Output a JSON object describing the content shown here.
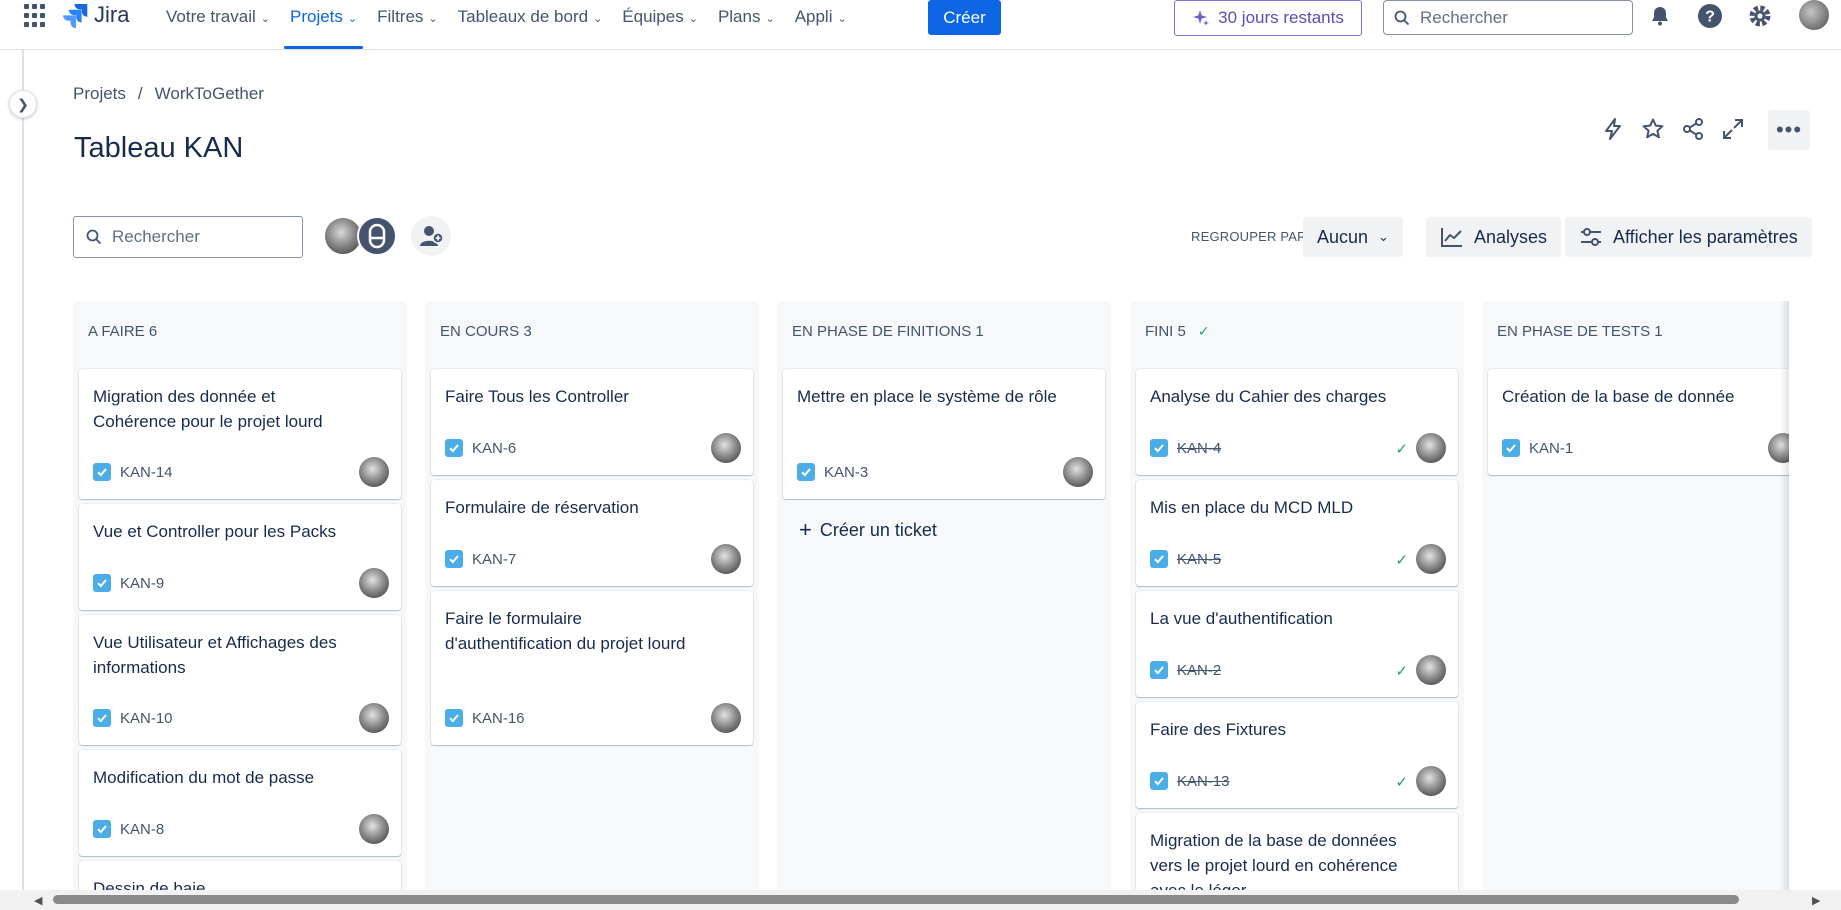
{
  "nav": {
    "logo": "Jira",
    "items": [
      {
        "label": "Votre travail"
      },
      {
        "label": "Projets"
      },
      {
        "label": "Filtres"
      },
      {
        "label": "Tableaux de bord"
      },
      {
        "label": "Équipes"
      },
      {
        "label": "Plans"
      },
      {
        "label": "Appli"
      }
    ],
    "active_item": "Projets",
    "create_label": "Créer",
    "trial_label": "30 jours restants",
    "search_placeholder": "Rechercher",
    "accent_color": "#0c66e4"
  },
  "breadcrumb": {
    "root": "Projets",
    "separator": "/",
    "project": "WorkToGether"
  },
  "page": {
    "title": "Tableau KAN"
  },
  "toolbar": {
    "search_placeholder": "Rechercher",
    "group_by_label": "REGROUPER PAR",
    "group_by_value": "Aucun",
    "analyses_label": "Analyses",
    "settings_label": "Afficher les paramètres"
  },
  "columns": [
    {
      "header": "A FAIRE 6",
      "cards": [
        {
          "title": "Migration des donnée et Cohérence pour le projet lourd",
          "key": "KAN-14",
          "done": false
        },
        {
          "title": "Vue et Controller pour les Packs",
          "key": "KAN-9",
          "done": false
        },
        {
          "title": "Vue Utilisateur et Affichages des informations",
          "key": "KAN-10",
          "done": false
        },
        {
          "title": "Modification du mot de passe",
          "key": "KAN-8",
          "done": false
        },
        {
          "title": "Dessin de baie",
          "key": "",
          "done": false
        }
      ]
    },
    {
      "header": "EN COURS 3",
      "cards": [
        {
          "title": "Faire Tous les Controller",
          "key": "KAN-6",
          "done": false
        },
        {
          "title": "Formulaire de réservation",
          "key": "KAN-7",
          "done": false
        },
        {
          "title": "Faire le formulaire d'authentification du projet lourd",
          "key": "KAN-16",
          "done": false
        }
      ]
    },
    {
      "header": "EN PHASE DE FINITIONS 1",
      "cards": [
        {
          "title": "Mettre en place le système de rôle",
          "key": "KAN-3",
          "done": false
        }
      ],
      "create_ticket_label": "Créer un ticket"
    },
    {
      "header": "FINI 5",
      "cards": [
        {
          "title": "Analyse du Cahier des charges",
          "key": "KAN-4",
          "done": true
        },
        {
          "title": "Mis en place du MCD MLD",
          "key": "KAN-5",
          "done": true
        },
        {
          "title": "La vue d'authentification",
          "key": "KAN-2",
          "done": true
        },
        {
          "title": "Faire des Fixtures",
          "key": "KAN-13",
          "done": true
        },
        {
          "title": "Migration de la base de données vers le projet lourd en cohérence avec le léger",
          "key": "",
          "done": true
        }
      ]
    },
    {
      "header": "EN PHASE DE TESTS 1",
      "cards": [
        {
          "title": "Création de la base de donnée",
          "key": "KAN-1",
          "done": false
        }
      ]
    }
  ]
}
